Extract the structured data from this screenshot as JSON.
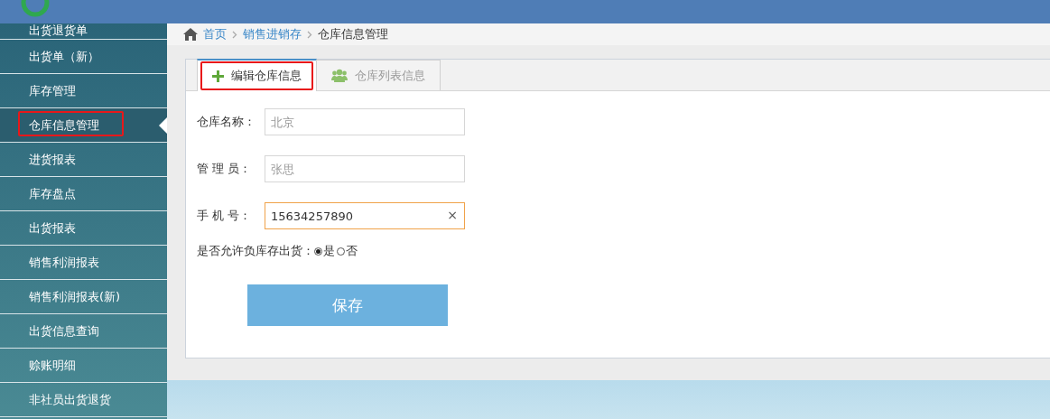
{
  "sidebar": {
    "items": [
      {
        "label": "出货退货单",
        "selected": false,
        "highlighted": false
      },
      {
        "label": "出货单（新）",
        "selected": false,
        "highlighted": false
      },
      {
        "label": "库存管理",
        "selected": false,
        "highlighted": false
      },
      {
        "label": "仓库信息管理",
        "selected": true,
        "highlighted": true
      },
      {
        "label": "进货报表",
        "selected": false,
        "highlighted": false
      },
      {
        "label": "库存盘点",
        "selected": false,
        "highlighted": false
      },
      {
        "label": "出货报表",
        "selected": false,
        "highlighted": false
      },
      {
        "label": "销售利润报表",
        "selected": false,
        "highlighted": false
      },
      {
        "label": "销售利润报表(新)",
        "selected": false,
        "highlighted": false
      },
      {
        "label": "出货信息查询",
        "selected": false,
        "highlighted": false
      },
      {
        "label": "赊账明细",
        "selected": false,
        "highlighted": false
      },
      {
        "label": "非社员出货退货",
        "selected": false,
        "highlighted": false
      }
    ]
  },
  "breadcrumb": [
    {
      "label": "首页",
      "kind": "link"
    },
    {
      "label": "销售进销存",
      "kind": "link"
    },
    {
      "label": "仓库信息管理",
      "kind": "current"
    }
  ],
  "tabs": [
    {
      "label": "编辑仓库信息",
      "selected": true,
      "highlighted": true,
      "kind": "add"
    },
    {
      "label": "仓库列表信息",
      "selected": false,
      "highlighted": false,
      "kind": "users"
    }
  ],
  "form": {
    "fields": [
      {
        "label": "仓库名称：",
        "placeholder": "北京",
        "focused": false
      },
      {
        "label": "管 理 员：",
        "placeholder": "张思",
        "focused": false
      },
      {
        "label": "手 机 号：",
        "value": "15634257890",
        "focused": true,
        "clear": "×"
      }
    ],
    "radio_group": {
      "label": "是否允许负库存出货：",
      "options": [
        {
          "label": "是",
          "selected": true
        },
        {
          "label": "否",
          "selected": false
        }
      ]
    },
    "save_button": "保存"
  }
}
